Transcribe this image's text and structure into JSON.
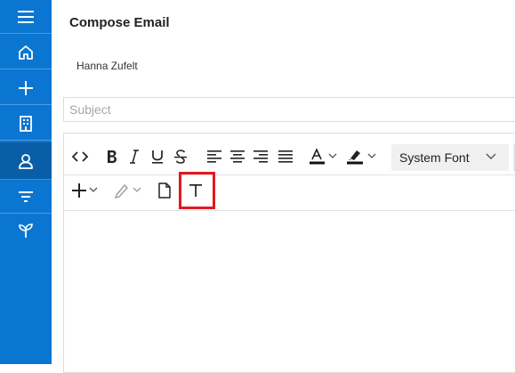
{
  "sidebar": {
    "items": [
      {
        "name": "menu-icon"
      },
      {
        "name": "home-icon"
      },
      {
        "name": "plus-icon"
      },
      {
        "name": "building-icon"
      },
      {
        "name": "contact-icon",
        "active": true
      },
      {
        "name": "filter-icon"
      },
      {
        "name": "plant-icon"
      }
    ],
    "color": "#0b76d1"
  },
  "page": {
    "title": "Compose Email"
  },
  "compose": {
    "recipient": "Hanna Zufelt",
    "subject_placeholder": "Subject",
    "subject_value": ""
  },
  "toolbar": {
    "font_family_value": "System Font",
    "row1": [
      "source-code-icon",
      "bold-icon",
      "italic-icon",
      "underline-icon",
      "strikethrough-icon",
      "align-left-icon",
      "align-center-icon",
      "align-right-icon",
      "justify-icon",
      "text-color-icon",
      "highlight-color-icon"
    ],
    "row2": [
      "insert-icon",
      "format-painter-icon",
      "document-icon",
      "text-icon"
    ],
    "highlighted_button": "text-icon",
    "highlight_color": "#e0191f"
  }
}
